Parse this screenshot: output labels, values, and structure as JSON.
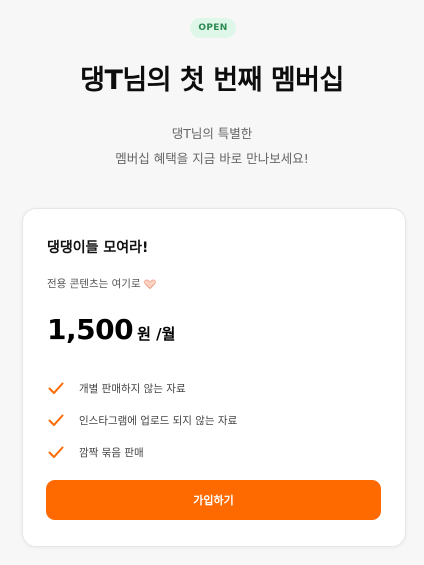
{
  "badge": "OPEN",
  "header": {
    "title": "댕T님의 첫 번째 멤버십",
    "subtitle_line1": "댕T님의 특별한",
    "subtitle_line2": "멤버십 혜택을 지금 바로 만나보세요!"
  },
  "plan": {
    "name": "댕댕이들 모여라!",
    "description": "전용 콘텐츠는 여기로",
    "description_icon": "heart-hands-icon",
    "price": "1,500",
    "price_unit": "원 /월",
    "features": [
      "개별 판매하지 않는 자료",
      "인스타그램에 업로드 되지 않는 자료",
      "깜짝 묶음 판매"
    ],
    "button_label": "가입하기"
  },
  "colors": {
    "accent": "#ff6a00",
    "badge_bg": "#dff7e8",
    "badge_text": "#2a8a52"
  }
}
